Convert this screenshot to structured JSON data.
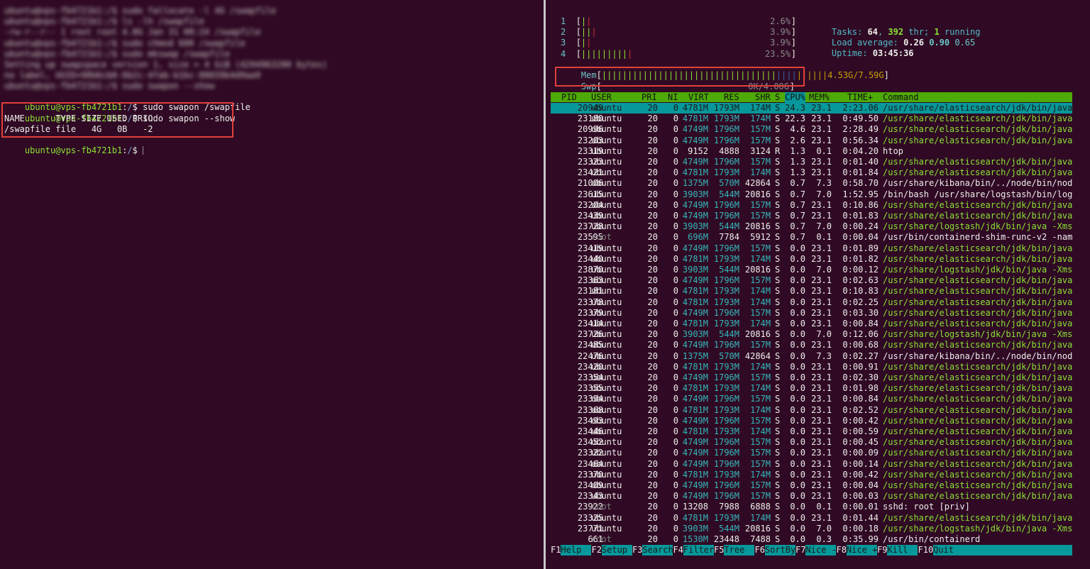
{
  "left_terminal": {
    "blurred_lines": [
      "ubuntu@vps-fb4721b1:/$ sudo fallocate -l 4G /swapfile",
      "ubuntu@vps-fb4721b1:/$ ls -lh /swapfile",
      "-rw-r--r-- 1 root root 4.0G Jan 31 08:24 /swapfile",
      "ubuntu@vps-fb4721b1:/$ sudo chmod 600 /swapfile",
      "ubuntu@vps-fb4721b1:/$ sudo mkswap /swapfile",
      "Setting up swapspace version 1, size = 4 GiB (4294963200 bytes)",
      "no label, UUID=98b6cb0-6b2c-4fab-b1bc-88659b4d9aa9",
      "ubuntu@vps-fb4721b1:/$ sudo swapon --show"
    ],
    "prompt_user": "ubuntu@vps-fb4721b1",
    "prompt_colon": ":",
    "prompt_path": "/",
    "prompt_sign": "$ ",
    "cmd1": "sudo swapon /swapfile",
    "cmd2": "sudo swapon --show",
    "table_header": "NAME      TYPE SIZE USED PRIO",
    "table_row": "/swapfile file   4G   0B   -2"
  },
  "htop": {
    "cpus": [
      {
        "num": "1",
        "bars": "||",
        "pct": "2.6%"
      },
      {
        "num": "2",
        "bars": "|||",
        "pct": "3.9%"
      },
      {
        "num": "3",
        "bars": "||",
        "pct": "3.9%"
      },
      {
        "num": "4",
        "bars": "||||||||||",
        "pct": "23.5%"
      }
    ],
    "mem_label": "Mem",
    "mem_bars": "||||||||||||||||||||||||||||||||||||||||||||",
    "mem_value": "4.53G/7.59G",
    "swp_label": "Swp",
    "swp_value": "0K/4.00G",
    "tasks_label": "Tasks:",
    "tasks": "64",
    "threads": "392",
    "thr_label": "thr;",
    "running": "1",
    "running_label": "running",
    "load_label": "Load average:",
    "load1": "0.26",
    "load5": "0.90",
    "load15": "0.65",
    "uptime_label": "Uptime:",
    "uptime": "03:45:36",
    "columns": [
      "PID",
      "USER",
      "PRI",
      "NI",
      "VIRT",
      "RES",
      "SHR",
      "S",
      "CPU%",
      "MEM%",
      "TIME+",
      "Command"
    ],
    "rows": [
      [
        "20949",
        "ubuntu",
        "20",
        "0",
        "4781M",
        "1793M",
        "174M",
        "S",
        "24.3",
        "23.1",
        "2:23.06",
        "/usr/share/elasticsearch/jdk/bin/java"
      ],
      [
        "23180",
        "ubuntu",
        "20",
        "0",
        "4781M",
        "1793M",
        "174M",
        "S",
        "22.3",
        "23.1",
        "0:49.50",
        "/usr/share/elasticsearch/jdk/bin/java"
      ],
      [
        "20996",
        "ubuntu",
        "20",
        "0",
        "4749M",
        "1796M",
        "157M",
        "S",
        "4.6",
        "23.1",
        "2:28.49",
        "/usr/share/elasticsearch/jdk/bin/java"
      ],
      [
        "23203",
        "ubuntu",
        "20",
        "0",
        "4749M",
        "1796M",
        "157M",
        "S",
        "2.6",
        "23.1",
        "0:56.34",
        "/usr/share/elasticsearch/jdk/bin/java"
      ],
      [
        "23319",
        "ubuntu",
        "20",
        "0",
        "9152",
        "4888",
        "3124",
        "R",
        "1.3",
        "0.1",
        "0:04.20",
        "htop"
      ],
      [
        "23323",
        "ubuntu",
        "20",
        "0",
        "4749M",
        "1796M",
        "157M",
        "S",
        "1.3",
        "23.1",
        "0:01.40",
        "/usr/share/elasticsearch/jdk/bin/java"
      ],
      [
        "23421",
        "ubuntu",
        "20",
        "0",
        "4781M",
        "1793M",
        "174M",
        "S",
        "1.3",
        "23.1",
        "0:01.84",
        "/usr/share/elasticsearch/jdk/bin/java"
      ],
      [
        "21006",
        "ubuntu",
        "20",
        "0",
        "1375M",
        "570M",
        "42864",
        "S",
        "0.7",
        "7.3",
        "0:58.70",
        "/usr/share/kibana/bin/../node/bin/nod"
      ],
      [
        "23615",
        "ubuntu",
        "20",
        "0",
        "3903M",
        "544M",
        "20816",
        "S",
        "0.7",
        "7.0",
        "1:52.95",
        "/bin/bash /usr/share/logstash/bin/log"
      ],
      [
        "23204",
        "ubuntu",
        "20",
        "0",
        "4749M",
        "1796M",
        "157M",
        "S",
        "0.7",
        "23.1",
        "0:10.86",
        "/usr/share/elasticsearch/jdk/bin/java"
      ],
      [
        "23439",
        "ubuntu",
        "20",
        "0",
        "4749M",
        "1796M",
        "157M",
        "S",
        "0.7",
        "23.1",
        "0:01.83",
        "/usr/share/elasticsearch/jdk/bin/java"
      ],
      [
        "23728",
        "ubuntu",
        "20",
        "0",
        "3903M",
        "544M",
        "20816",
        "S",
        "0.7",
        "7.0",
        "0:00.24",
        "/usr/share/logstash/jdk/bin/java -Xms"
      ],
      [
        "23595",
        "root",
        "20",
        "0",
        "696M",
        "7784",
        "5912",
        "S",
        "0.7",
        "0.1",
        "0:00.04",
        "/usr/bin/containerd-shim-runc-v2 -nam"
      ],
      [
        "23419",
        "ubuntu",
        "20",
        "0",
        "4749M",
        "1796M",
        "157M",
        "S",
        "0.0",
        "23.1",
        "0:01.89",
        "/usr/share/elasticsearch/jdk/bin/java"
      ],
      [
        "23440",
        "ubuntu",
        "20",
        "0",
        "4781M",
        "1793M",
        "174M",
        "S",
        "0.0",
        "23.1",
        "0:01.82",
        "/usr/share/elasticsearch/jdk/bin/java"
      ],
      [
        "23870",
        "ubuntu",
        "20",
        "0",
        "3903M",
        "544M",
        "20816",
        "S",
        "0.0",
        "7.0",
        "0:00.12",
        "/usr/share/logstash/jdk/bin/java -Xms"
      ],
      [
        "23363",
        "ubuntu",
        "20",
        "0",
        "4749M",
        "1796M",
        "157M",
        "S",
        "0.0",
        "23.1",
        "0:02.63",
        "/usr/share/elasticsearch/jdk/bin/java"
      ],
      [
        "23181",
        "ubuntu",
        "20",
        "0",
        "4781M",
        "1793M",
        "174M",
        "S",
        "0.0",
        "23.1",
        "0:10.83",
        "/usr/share/elasticsearch/jdk/bin/java"
      ],
      [
        "23378",
        "ubuntu",
        "20",
        "0",
        "4781M",
        "1793M",
        "174M",
        "S",
        "0.0",
        "23.1",
        "0:02.25",
        "/usr/share/elasticsearch/jdk/bin/java"
      ],
      [
        "23379",
        "ubuntu",
        "20",
        "0",
        "4749M",
        "1796M",
        "157M",
        "S",
        "0.0",
        "23.1",
        "0:03.30",
        "/usr/share/elasticsearch/jdk/bin/java"
      ],
      [
        "23414",
        "ubuntu",
        "20",
        "0",
        "4781M",
        "1793M",
        "174M",
        "S",
        "0.0",
        "23.1",
        "0:00.84",
        "/usr/share/elasticsearch/jdk/bin/java"
      ],
      [
        "23726",
        "ubuntu",
        "20",
        "0",
        "3903M",
        "544M",
        "20816",
        "S",
        "0.0",
        "7.0",
        "0:12.06",
        "/usr/share/logstash/jdk/bin/java -Xms"
      ],
      [
        "23485",
        "ubuntu",
        "20",
        "0",
        "4749M",
        "1796M",
        "157M",
        "S",
        "0.0",
        "23.1",
        "0:00.68",
        "/usr/share/elasticsearch/jdk/bin/java"
      ],
      [
        "22476",
        "ubuntu",
        "20",
        "0",
        "1375M",
        "570M",
        "42864",
        "S",
        "0.0",
        "7.3",
        "0:02.27",
        "/usr/share/kibana/bin/../node/bin/nod"
      ],
      [
        "23420",
        "ubuntu",
        "20",
        "0",
        "4781M",
        "1793M",
        "174M",
        "S",
        "0.0",
        "23.1",
        "0:00.91",
        "/usr/share/elasticsearch/jdk/bin/java"
      ],
      [
        "23354",
        "ubuntu",
        "20",
        "0",
        "4749M",
        "1796M",
        "157M",
        "S",
        "0.0",
        "23.1",
        "0:02.30",
        "/usr/share/elasticsearch/jdk/bin/java"
      ],
      [
        "23355",
        "ubuntu",
        "20",
        "0",
        "4781M",
        "1793M",
        "174M",
        "S",
        "0.0",
        "23.1",
        "0:01.98",
        "/usr/share/elasticsearch/jdk/bin/java"
      ],
      [
        "23394",
        "ubuntu",
        "20",
        "0",
        "4749M",
        "1796M",
        "157M",
        "S",
        "0.0",
        "23.1",
        "0:00.84",
        "/usr/share/elasticsearch/jdk/bin/java"
      ],
      [
        "23368",
        "ubuntu",
        "20",
        "0",
        "4781M",
        "1793M",
        "174M",
        "S",
        "0.0",
        "23.1",
        "0:02.52",
        "/usr/share/elasticsearch/jdk/bin/java"
      ],
      [
        "23493",
        "ubuntu",
        "20",
        "0",
        "4749M",
        "1796M",
        "157M",
        "S",
        "0.0",
        "23.1",
        "0:00.42",
        "/usr/share/elasticsearch/jdk/bin/java"
      ],
      [
        "23446",
        "ubuntu",
        "20",
        "0",
        "4781M",
        "1793M",
        "174M",
        "S",
        "0.0",
        "23.1",
        "0:00.59",
        "/usr/share/elasticsearch/jdk/bin/java"
      ],
      [
        "23452",
        "ubuntu",
        "20",
        "0",
        "4749M",
        "1796M",
        "157M",
        "S",
        "0.0",
        "23.1",
        "0:00.45",
        "/usr/share/elasticsearch/jdk/bin/java"
      ],
      [
        "23322",
        "ubuntu",
        "20",
        "0",
        "4749M",
        "1796M",
        "157M",
        "S",
        "0.0",
        "23.1",
        "0:00.09",
        "/usr/share/elasticsearch/jdk/bin/java"
      ],
      [
        "23464",
        "ubuntu",
        "20",
        "0",
        "4749M",
        "1796M",
        "157M",
        "S",
        "0.0",
        "23.1",
        "0:00.14",
        "/usr/share/elasticsearch/jdk/bin/java"
      ],
      [
        "23370",
        "ubuntu",
        "20",
        "0",
        "4781M",
        "1793M",
        "174M",
        "S",
        "0.0",
        "23.1",
        "0:00.42",
        "/usr/share/elasticsearch/jdk/bin/java"
      ],
      [
        "23409",
        "ubuntu",
        "20",
        "0",
        "4749M",
        "1796M",
        "157M",
        "S",
        "0.0",
        "23.1",
        "0:00.04",
        "/usr/share/elasticsearch/jdk/bin/java"
      ],
      [
        "23343",
        "ubuntu",
        "20",
        "0",
        "4749M",
        "1796M",
        "157M",
        "S",
        "0.0",
        "23.1",
        "0:00.03",
        "/usr/share/elasticsearch/jdk/bin/java"
      ],
      [
        "23922",
        "root",
        "20",
        "0",
        "13208",
        "7988",
        "6888",
        "S",
        "0.0",
        "0.1",
        "0:00.01",
        "sshd: root [priv]"
      ],
      [
        "23325",
        "ubuntu",
        "20",
        "0",
        "4781M",
        "1793M",
        "174M",
        "S",
        "0.0",
        "23.1",
        "0:01.44",
        "/usr/share/elasticsearch/jdk/bin/java"
      ],
      [
        "23771",
        "ubuntu",
        "20",
        "0",
        "3903M",
        "544M",
        "20816",
        "S",
        "0.0",
        "7.0",
        "0:00.18",
        "/usr/share/logstash/jdk/bin/java -Xms"
      ],
      [
        "661",
        "root",
        "20",
        "0",
        "1530M",
        "23448",
        "7488",
        "S",
        "0.0",
        "0.3",
        "0:35.99",
        "/usr/bin/containerd"
      ]
    ],
    "fkeys": [
      {
        "key": "F1",
        "label": "Help"
      },
      {
        "key": "F2",
        "label": "Setup"
      },
      {
        "key": "F3",
        "label": "Search"
      },
      {
        "key": "F4",
        "label": "Filter"
      },
      {
        "key": "F5",
        "label": "Tree"
      },
      {
        "key": "F6",
        "label": "SortBy"
      },
      {
        "key": "F7",
        "label": "Nice -"
      },
      {
        "key": "F8",
        "label": "Nice +"
      },
      {
        "key": "F9",
        "label": "Kill"
      },
      {
        "key": "F10",
        "label": "Quit"
      }
    ],
    "colors": {
      "header_bg": "#4eaa06",
      "selected_bg": "#06989a",
      "path_green": "#8ae234",
      "num_teal": "#34b7b9",
      "highlight_red": "#e0413a"
    }
  }
}
